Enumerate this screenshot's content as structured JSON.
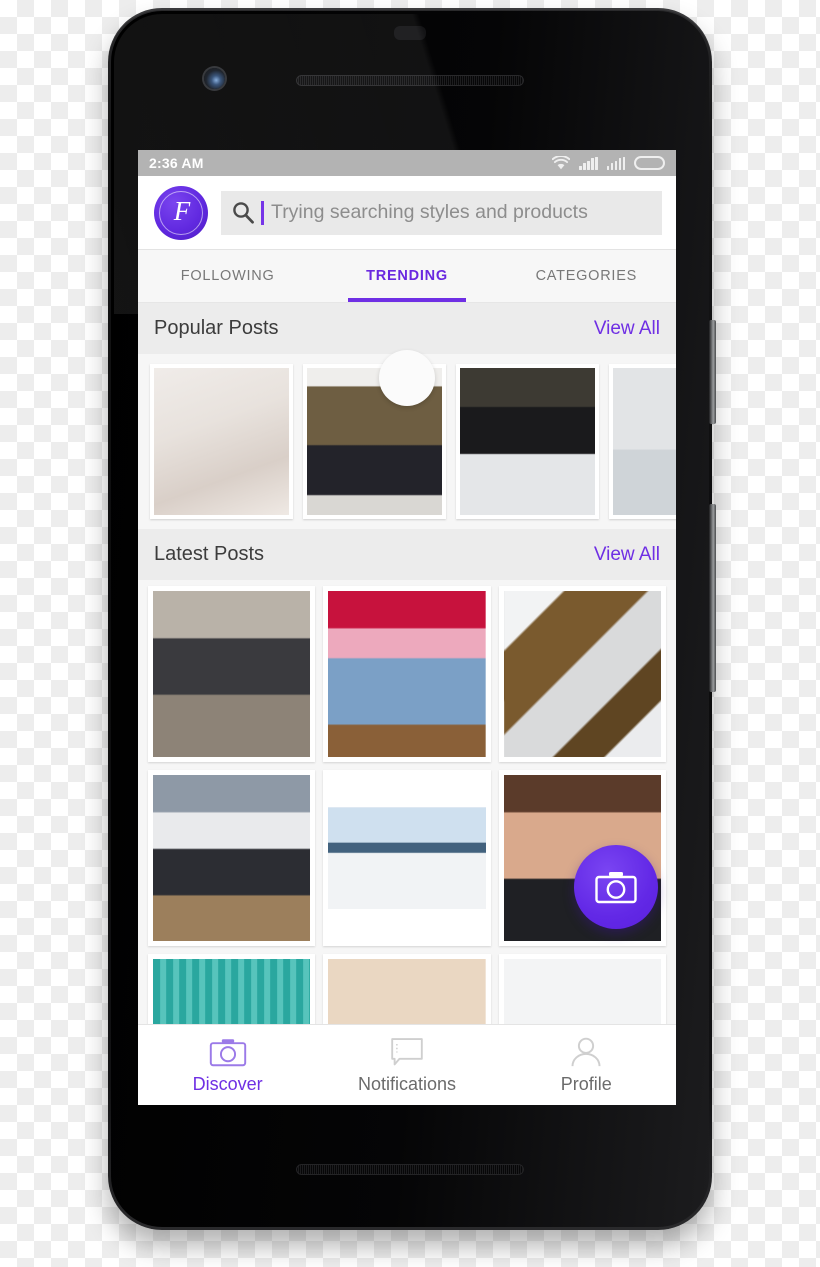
{
  "device": {
    "name": "android-smartphone-mockup",
    "hardware": {
      "power_button": "power-button",
      "volume_button": "volume-rocker",
      "front_camera": "front-camera",
      "earpiece": "earpiece-speaker",
      "bottom_speaker": "bottom-speaker"
    }
  },
  "status_bar": {
    "time": "2:36 AM",
    "icons": [
      "wifi-icon",
      "signal-icon-sim1",
      "signal-icon-sim2",
      "battery-icon"
    ]
  },
  "app_bar": {
    "logo_monogram": "F",
    "logo_name": "app-logo",
    "search": {
      "icon": "search-icon",
      "placeholder": "Trying searching styles and products",
      "value": "",
      "cursor_visible": true
    }
  },
  "tabs": {
    "active": "TRENDING",
    "items": [
      {
        "label": "FOLLOWING",
        "active": false
      },
      {
        "label": "TRENDING",
        "active": true
      },
      {
        "label": "CATEGORIES",
        "active": false
      }
    ]
  },
  "refresh": {
    "spinner_visible": true
  },
  "sections": [
    {
      "title": "Popular Posts",
      "action_label": "View All",
      "layout": "carousel",
      "items": [
        {
          "name": "post-kid-valentines",
          "style": "img-kid"
        },
        {
          "name": "post-outfit-pair",
          "style": "img-pair"
        },
        {
          "name": "post-snow-coat",
          "style": "img-snow1"
        },
        {
          "name": "post-floral-partial",
          "style": "img-snow2"
        }
      ]
    },
    {
      "title": "Latest Posts",
      "action_label": "View All",
      "layout": "grid",
      "items": [
        {
          "name": "post-paris-cafe",
          "style": "img-cafe",
          "fit": "cover"
        },
        {
          "name": "post-denim-trio",
          "style": "img-denim",
          "fit": "cover"
        },
        {
          "name": "post-handbags-flatlay",
          "style": "img-bags",
          "fit": "cover"
        },
        {
          "name": "post-white-fence",
          "style": "img-fence",
          "fit": "cover"
        },
        {
          "name": "post-snow-field",
          "style": "img-field",
          "fit": "contain"
        },
        {
          "name": "post-selfie-bun",
          "style": "img-selfie",
          "fit": "cover"
        },
        {
          "name": "post-teal-wall",
          "style": "img-teal",
          "fit": "cover"
        },
        {
          "name": "post-tan-interior",
          "style": "img-tan",
          "fit": "cover"
        },
        {
          "name": "post-light-ceiling",
          "style": "img-light",
          "fit": "cover"
        }
      ]
    }
  ],
  "fab": {
    "icon": "camera-icon",
    "color": "#6228e6"
  },
  "bottom_nav": {
    "active": "Discover",
    "items": [
      {
        "label": "Discover",
        "icon": "camera-icon",
        "active": true
      },
      {
        "label": "Notifications",
        "icon": "speech-bubble-icon",
        "active": false
      },
      {
        "label": "Profile",
        "icon": "person-icon",
        "active": false
      }
    ]
  },
  "colors": {
    "accent_purple": "#6f2fe4",
    "status_bar_gray": "#b3b3b3",
    "section_header_gray": "#ececec",
    "placeholder_gray": "#8d8d8d"
  }
}
